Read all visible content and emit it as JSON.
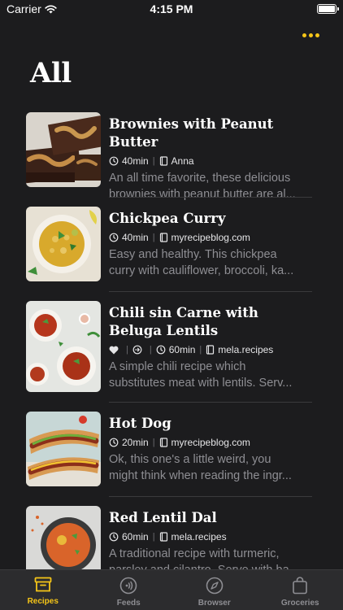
{
  "status": {
    "carrier": "Carrier",
    "time": "4:15 PM"
  },
  "header": {
    "title": "All"
  },
  "recipes": [
    {
      "title_lines": [
        "Brownies with Peanut Butter"
      ],
      "time": "40min",
      "source": "Anna",
      "desc_lines": [
        "An all time favorite, these delicious",
        "brownies with peanut butter are al..."
      ]
    },
    {
      "title_lines": [
        "Chickpea Curry"
      ],
      "time": "40min",
      "source": "myrecipeblog.com",
      "desc_lines": [
        "Easy and healthy. This chickpea",
        "curry with cauliflower, broccoli, ka..."
      ]
    },
    {
      "title_lines": [
        "Chili sin Carne with",
        "Beluga Lentils"
      ],
      "favorite": true,
      "time": "60min",
      "source": "mela.recipes",
      "desc_lines": [
        "A simple chili recipe which",
        "substitutes meat with lentils. Serv..."
      ]
    },
    {
      "title_lines": [
        "Hot Dog"
      ],
      "time": "20min",
      "source": "myrecipeblog.com",
      "desc_lines": [
        "Ok, this one's a little weird, you",
        "might think when reading the ingr..."
      ]
    },
    {
      "title_lines": [
        "Red Lentil Dal"
      ],
      "time": "60min",
      "source": "mela.recipes",
      "desc_lines": [
        "A traditional recipe with turmeric,",
        "parsley and cilantro. Serve with ba..."
      ]
    }
  ],
  "tabs": [
    {
      "label": "Recipes",
      "icon": "archive-box-icon",
      "active": true
    },
    {
      "label": "Feeds",
      "icon": "feed-icon",
      "active": false
    },
    {
      "label": "Browser",
      "icon": "compass-icon",
      "active": false
    },
    {
      "label": "Groceries",
      "icon": "shopping-bag-icon",
      "active": false
    }
  ],
  "colors": {
    "accent": "#f5c518",
    "background": "#1c1c1e",
    "tab_bar": "#2c2c2e"
  }
}
